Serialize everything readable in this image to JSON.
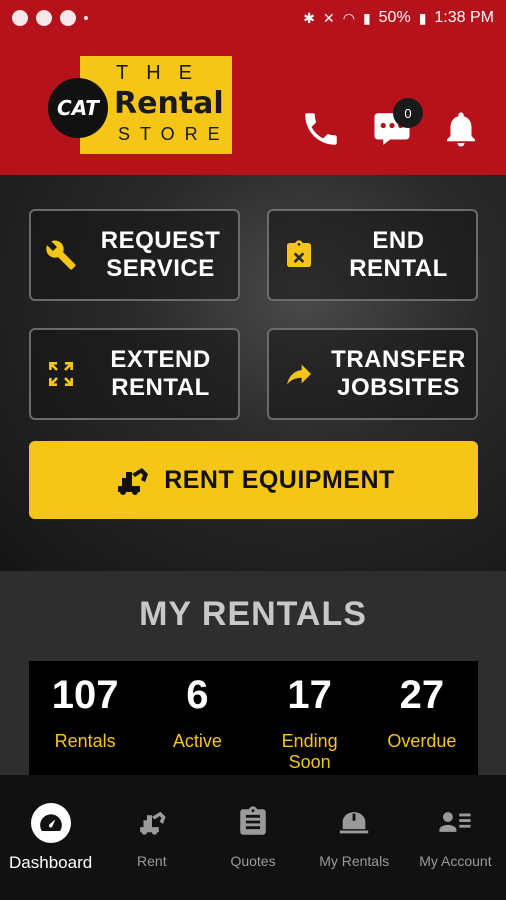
{
  "status_bar": {
    "battery": "50%",
    "time": "1:38 PM"
  },
  "header": {
    "logo": {
      "cat": "CAT",
      "the": "THE",
      "rental": "Rental",
      "store": "STORE"
    },
    "icons": [
      "phone-icon",
      "chat-icon",
      "bell-icon"
    ],
    "chat_badge": "0"
  },
  "actions": {
    "request_service": "REQUEST\nSERVICE",
    "end_rental": "END\nRENTAL",
    "extend_rental": "EXTEND\nRENTAL",
    "transfer_jobsites": "TRANSFER\nJOBSITES",
    "rent_equipment": "RENT EQUIPMENT"
  },
  "my_rentals": {
    "title": "MY RENTALS",
    "stats": [
      {
        "value": "107",
        "label": "Rentals"
      },
      {
        "value": "6",
        "label": "Active"
      },
      {
        "value": "17",
        "label": "Ending\nSoon"
      },
      {
        "value": "27",
        "label": "Overdue"
      }
    ]
  },
  "nav": [
    {
      "label": "Dashboard",
      "icon": "dashboard-icon",
      "active": true
    },
    {
      "label": "Rent",
      "icon": "excavator-icon",
      "active": false
    },
    {
      "label": "Quotes",
      "icon": "clipboard-icon",
      "active": false
    },
    {
      "label": "My Rentals",
      "icon": "hardhat-icon",
      "active": false
    },
    {
      "label": "My Account",
      "icon": "account-icon",
      "active": false
    }
  ],
  "colors": {
    "brand_red": "#b5121b",
    "brand_yellow": "#f5c518"
  }
}
